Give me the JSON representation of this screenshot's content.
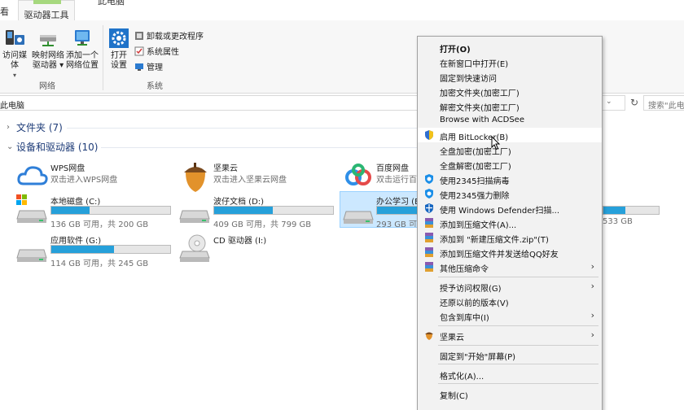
{
  "ribbon": {
    "tab_left": "看",
    "tab_active": "驱动器工具",
    "tab_extra": "此电脑",
    "access_media": "访问媒体",
    "map_drive_line1": "映射网络",
    "map_drive_line2": "驱动器 ▾",
    "add_location_line1": "添加一个",
    "add_location_line2": "网络位置",
    "group_network": "网络",
    "open_settings_line1": "打开",
    "open_settings_line2": "设置",
    "uninstall": "卸载或更改程序",
    "system_props": "系统属性",
    "manage": "管理",
    "group_system": "系统"
  },
  "address": {
    "path": "此电脑",
    "search_placeholder": "搜索\"此电"
  },
  "sections": {
    "folders": "文件夹 (7)",
    "drives": "设备和驱动器 (10)"
  },
  "clouds": [
    {
      "name": "WPS网盘",
      "sub": "双击进入WPS网盘"
    },
    {
      "name": "坚果云",
      "sub": "双击进入坚果云网盘"
    },
    {
      "name": "百度网盘",
      "sub": "双击运行百度"
    }
  ],
  "drives": [
    {
      "name": "本地磁盘 (C:)",
      "free": "136 GB 可用，共 200 GB",
      "used_fraction": 0.32
    },
    {
      "name": "波仔文档 (D:)",
      "free": "409 GB 可用，共 799 GB",
      "used_fraction": 0.49
    },
    {
      "name": "办公学习 (E",
      "free": "293 GB 可",
      "used_fraction": 0.72
    },
    {
      "name": "应用软件 (G:)",
      "free": "114 GB 可用，共 245 GB",
      "used_fraction": 0.53
    },
    {
      "name": "CD 驱动器 (I:)",
      "free": ""
    },
    {
      "name": "",
      "free": "533 GB",
      "used_fraction": 0.4
    }
  ],
  "menu": {
    "items": [
      {
        "label": "打开(O)"
      },
      {
        "label": "在新窗口中打开(E)"
      },
      {
        "label": "固定到快速访问"
      },
      {
        "label": "加密文件夹(加密工厂)"
      },
      {
        "label": "解密文件夹(加密工厂)"
      },
      {
        "label": "Browse with ACDSee"
      },
      {
        "label": "启用 BitLocker(B)"
      },
      {
        "label": "全盘加密(加密工厂)"
      },
      {
        "label": "全盘解密(加密工厂)"
      },
      {
        "label": "使用2345扫描病毒"
      },
      {
        "label": "使用2345强力删除"
      },
      {
        "label": "使用 Windows Defender扫描..."
      },
      {
        "label": "添加到压缩文件(A)..."
      },
      {
        "label": "添加到 \"新建压缩文件.zip\"(T)"
      },
      {
        "label": "添加到压缩文件并发送给QQ好友"
      },
      {
        "label": "其他压缩命令"
      },
      {
        "label": "授予访问权限(G)"
      },
      {
        "label": "还原以前的版本(V)"
      },
      {
        "label": "包含到库中(I)"
      },
      {
        "label": "坚果云"
      },
      {
        "label": "固定到\"开始\"屏幕(P)"
      },
      {
        "label": "格式化(A)..."
      },
      {
        "label": "复制(C)"
      }
    ]
  },
  "colors": {
    "accent": "#26a0da",
    "selection": "#cce8ff",
    "section_text": "#1e3c78"
  }
}
